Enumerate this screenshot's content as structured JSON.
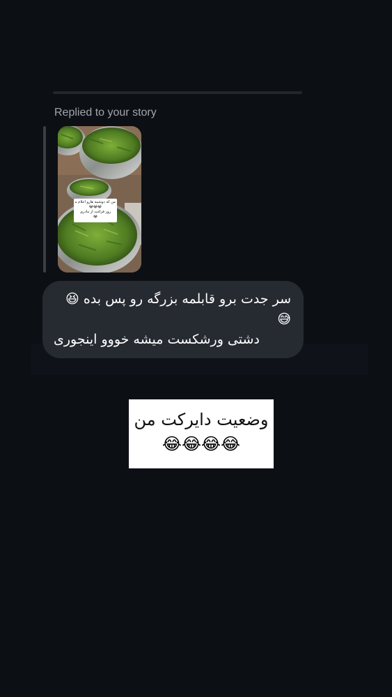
{
  "conversation": {
    "reply_context_label": "Replied to your story",
    "story": {
      "sticker_lines": [
        "من که دوشنبه هارو اعلام میکنم",
        "😂😂😂",
        "روز فراغت از مادری",
        "😂"
      ]
    },
    "message": {
      "line1": "سر جدت برو قابلمه بزرگه رو پس بده 😆",
      "line2": "😅",
      "line3": "دشتی ورشکست میشه خووو اینجوری"
    }
  },
  "shared_sticker": {
    "caption": "وضعیت دایرکت من",
    "emojis": "😂😂😂😂"
  },
  "colors": {
    "background": "#0c1015",
    "bubble": "#262a31",
    "label": "#a2a6ad",
    "quote_bar": "#3a3f48"
  }
}
